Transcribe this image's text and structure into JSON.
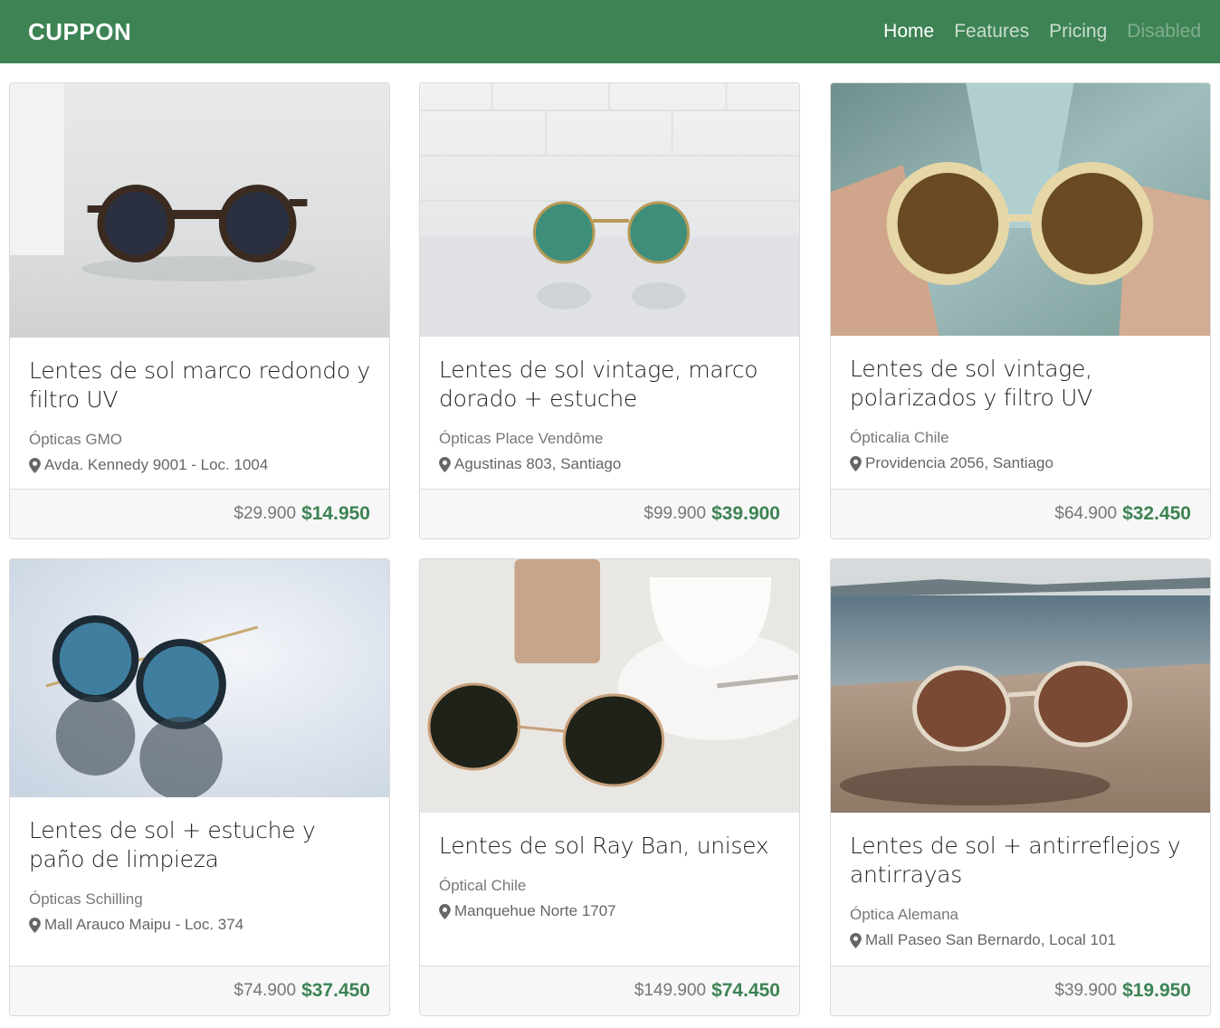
{
  "navbar": {
    "brand": "CUPPON",
    "links": [
      {
        "label": "Home",
        "state": "active"
      },
      {
        "label": "Features",
        "state": "normal"
      },
      {
        "label": "Pricing",
        "state": "normal"
      },
      {
        "label": "Disabled",
        "state": "disabled"
      }
    ]
  },
  "colors": {
    "brand": "#3d8354",
    "price": "#3d8354"
  },
  "icons": {
    "location": "map-marker-icon"
  },
  "cards": [
    {
      "title": "Lentes de sol marco redondo y filtro UV",
      "vendor": "Ópticas GMO",
      "address": "Avda. Kennedy 9001 - Loc. 1004",
      "old_price": "$29.900",
      "new_price": "$14.950"
    },
    {
      "title": "Lentes de sol vintage, marco dorado + estuche",
      "vendor": "Ópticas Place Vendôme",
      "address": "Agustinas 803, Santiago",
      "old_price": "$99.900",
      "new_price": "$39.900"
    },
    {
      "title": "Lentes de sol vintage, polarizados y filtro UV",
      "vendor": "Ópticalia Chile",
      "address": "Providencia 2056, Santiago",
      "old_price": "$64.900",
      "new_price": "$32.450"
    },
    {
      "title": "Lentes de sol + estuche y paño de limpieza",
      "vendor": "Ópticas Schilling",
      "address": "Mall Arauco Maipu - Loc. 374",
      "old_price": "$74.900",
      "new_price": "$37.450"
    },
    {
      "title": "Lentes de sol Ray Ban, unisex",
      "vendor": "Óptical Chile",
      "address": "Manquehue Norte 1707",
      "old_price": "$149.900",
      "new_price": "$74.450"
    },
    {
      "title": "Lentes de sol + antirreflejos y antirrayas",
      "vendor": "Óptica Alemana",
      "address": "Mall Paseo San Bernardo, Local 101",
      "old_price": "$39.900",
      "new_price": "$19.950"
    }
  ]
}
